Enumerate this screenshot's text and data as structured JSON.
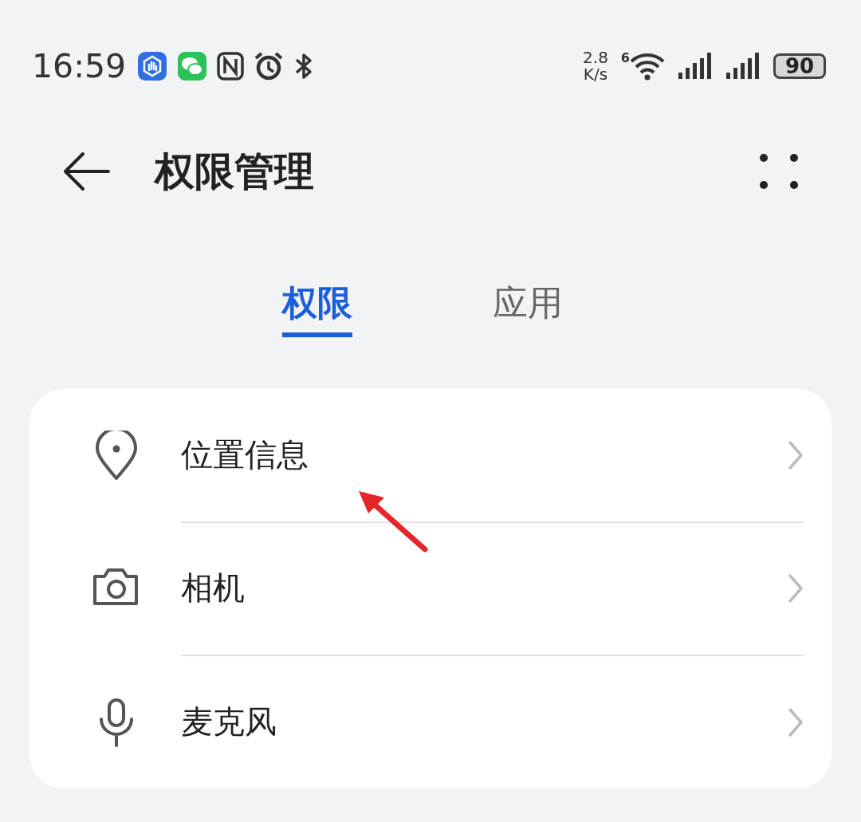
{
  "status_bar": {
    "time": "16:59",
    "net_speed": "2.8",
    "net_unit": "K/s",
    "wifi_badge": "6",
    "battery": "90"
  },
  "header": {
    "title": "权限管理"
  },
  "tabs": [
    {
      "label": "权限",
      "selected": true
    },
    {
      "label": "应用",
      "selected": false
    }
  ],
  "permissions": [
    {
      "kind": "location",
      "label": "位置信息"
    },
    {
      "kind": "camera",
      "label": "相机"
    },
    {
      "kind": "microphone",
      "label": "麦克风"
    }
  ]
}
